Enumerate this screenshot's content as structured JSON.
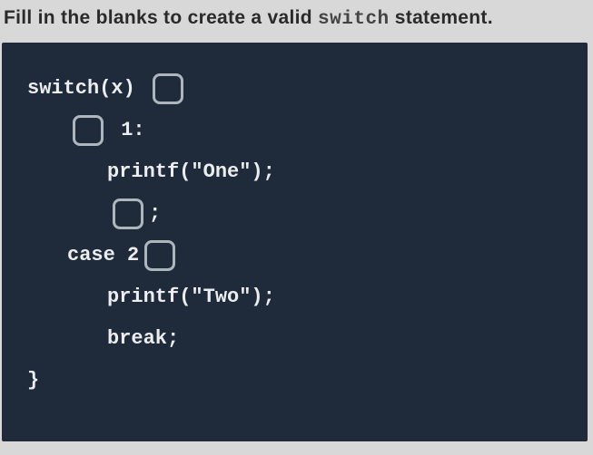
{
  "prompt": {
    "before": "Fill in the blanks to create a valid ",
    "kw1": "switch",
    "mid": " statement."
  },
  "code": {
    "l1a": "switch(x) ",
    "l2b": " 1:",
    "l3": "printf(\"One\");",
    "l4b": ";",
    "l5a": "case 2",
    "l6": "printf(\"Two\");",
    "l7": "break;",
    "l8": "}"
  }
}
